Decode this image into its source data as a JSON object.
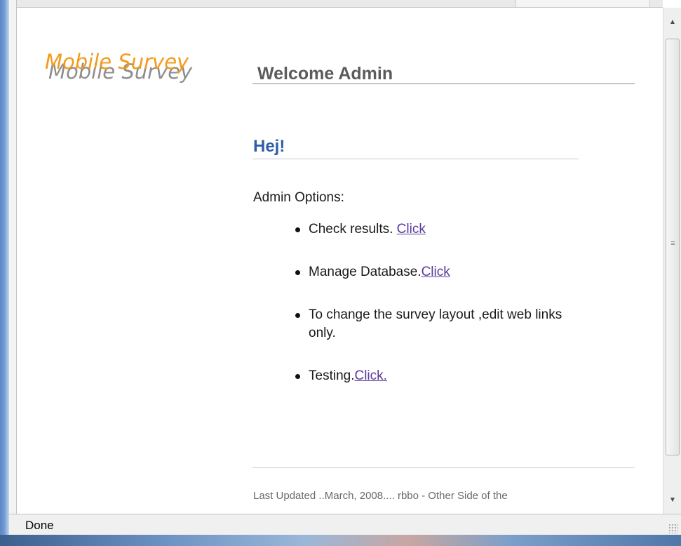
{
  "app": {
    "logo_text": "Mobile Survey"
  },
  "header": {
    "title": "Welcome Admin"
  },
  "main": {
    "greeting": "Hej!",
    "options_label": "Admin Options:",
    "options": [
      {
        "text": "Check results. ",
        "link": "Click"
      },
      {
        "text": "Manage Database.",
        "link": "Click"
      },
      {
        "text": "To change the survey layout ,edit web links only.",
        "link": ""
      },
      {
        "text": "Testing.",
        "link": "Click."
      }
    ]
  },
  "footer": {
    "text": "Last Updated ..March, 2008.... rbbo - Other Side of the"
  },
  "statusbar": {
    "text": "Done"
  },
  "colors": {
    "logo": "#f39a1a",
    "greeting": "#2e5ea8",
    "link_visited": "#5a3a99"
  }
}
